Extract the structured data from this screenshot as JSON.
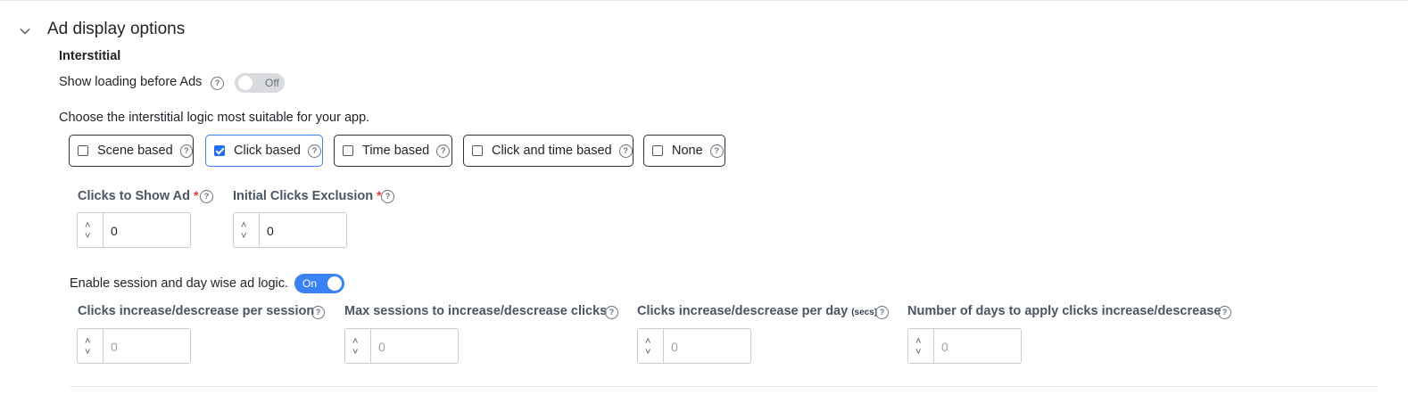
{
  "section": {
    "title": "Ad display options",
    "chevron_icon": "chevron-down-icon"
  },
  "interstitial": {
    "title": "Interstitial",
    "show_loading": {
      "label": "Show loading before Ads",
      "toggle_text": "Off",
      "state": "off"
    },
    "logic_prompt": "Choose the interstitial logic most suitable for your app.",
    "options": [
      {
        "label": "Scene based",
        "checked": false
      },
      {
        "label": "Click based",
        "checked": true
      },
      {
        "label": "Time based",
        "checked": false
      },
      {
        "label": "Click and time based",
        "checked": false
      },
      {
        "label": "None",
        "checked": false
      }
    ],
    "click_fields": [
      {
        "label": "Clicks to Show Ad",
        "required_mark": "*",
        "value": "0"
      },
      {
        "label": "Initial Clicks Exclusion",
        "required_mark": "*",
        "value": "0"
      }
    ],
    "session_logic": {
      "label": "Enable session and day wise ad logic.",
      "toggle_text": "On",
      "state": "on"
    },
    "session_fields": [
      {
        "label": "Clicks increase/descrease per session",
        "unit": "",
        "placeholder": "0"
      },
      {
        "label": "Max sessions to increase/descrease clicks",
        "unit": "",
        "placeholder": "0"
      },
      {
        "label": "Clicks increase/descrease per day",
        "unit": "(secs)",
        "placeholder": "0"
      },
      {
        "label": "Number of days to apply clicks increase/descrease",
        "unit": "",
        "placeholder": "0"
      }
    ]
  },
  "icons": {
    "help": "help-circle-icon",
    "up": "chevron-up-icon",
    "down": "chevron-down-icon"
  },
  "colors": {
    "accent": "#3b82f6",
    "required": "#e53935",
    "toggle_off": "#d8dadd"
  }
}
